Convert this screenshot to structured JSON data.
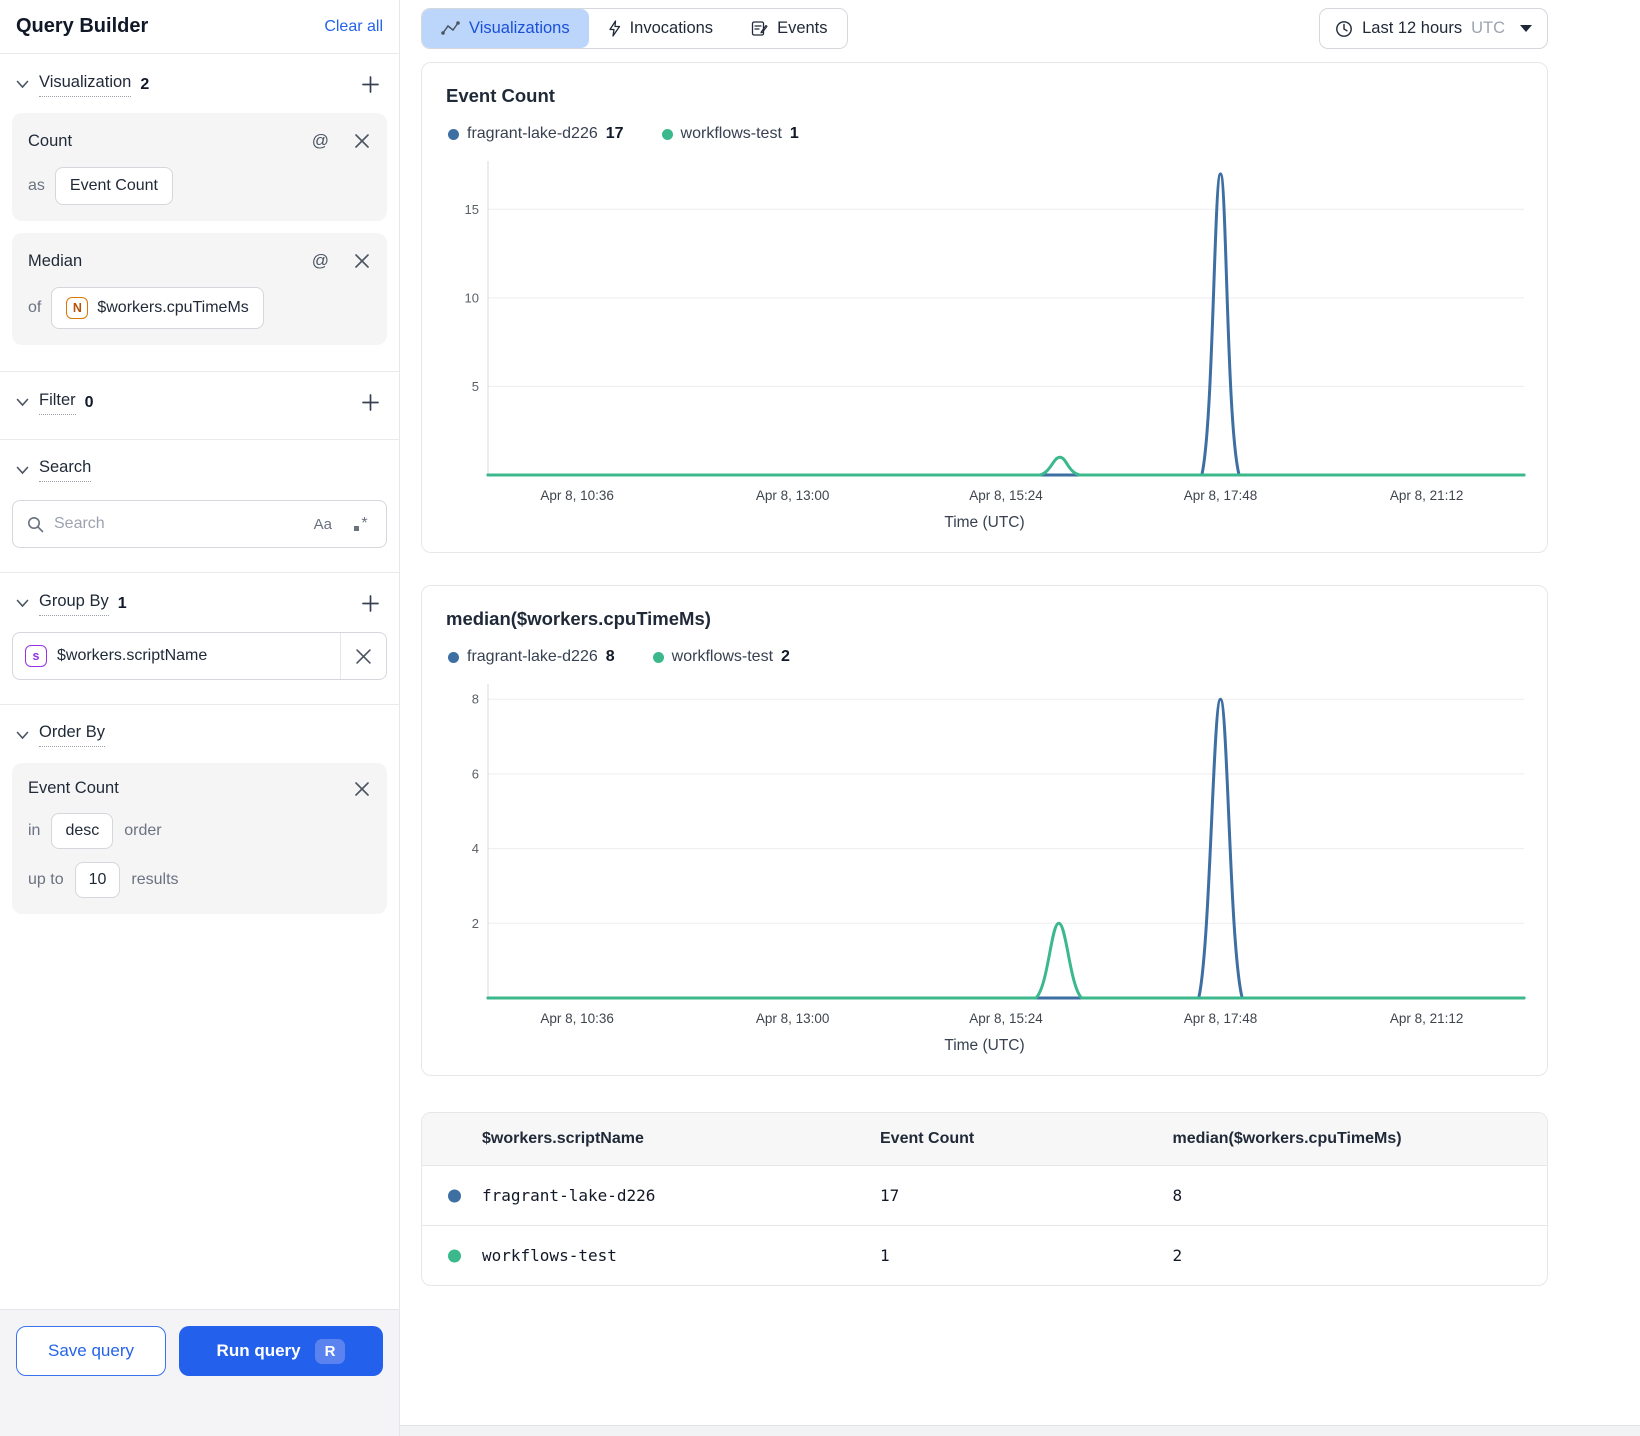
{
  "colors": {
    "accent": "#2563eb",
    "blue_series": "#3d6fa3",
    "green_series": "#3cb98c",
    "tab_selected_bg": "#bcd6fb",
    "tab_selected_text": "#1b4fd8"
  },
  "sidebar": {
    "title": "Query Builder",
    "clear_all": "Clear all",
    "visualization": {
      "label": "Visualization",
      "count": "2"
    },
    "count_card": {
      "title": "Count",
      "as_label": "as",
      "as_value": "Event Count"
    },
    "median_card": {
      "title": "Median",
      "of_label": "of",
      "field_badge": "N",
      "field": "$workers.cpuTimeMs"
    },
    "filter": {
      "label": "Filter",
      "count": "0"
    },
    "search": {
      "label": "Search",
      "placeholder": "Search",
      "case_toggle": "Aa"
    },
    "group_by": {
      "label": "Group By",
      "count": "1",
      "item_badge": "s",
      "item": "$workers.scriptName"
    },
    "order_by": {
      "label": "Order By",
      "card": {
        "title": "Event Count",
        "in_label": "in",
        "direction": "desc",
        "order_label": "order",
        "up_to_label": "up to",
        "limit": "10",
        "results_label": "results"
      }
    },
    "footer": {
      "save": "Save query",
      "run": "Run query",
      "run_shortcut": "R"
    }
  },
  "topbar": {
    "tabs": [
      {
        "label": "Visualizations",
        "selected": true
      },
      {
        "label": "Invocations",
        "selected": false
      },
      {
        "label": "Events",
        "selected": false
      }
    ],
    "time_range": {
      "label": "Last 12 hours",
      "zone": "UTC"
    }
  },
  "chart_data": [
    {
      "type": "line",
      "title": "Event Count",
      "xlabel": "Time (UTC)",
      "ylim": [
        0,
        17.5
      ],
      "y_ticks": [
        5,
        10,
        15
      ],
      "x_ticks": [
        {
          "pos": 0.086,
          "label": "Apr 8, 10:36"
        },
        {
          "pos": 0.294,
          "label": "Apr 8, 13:00"
        },
        {
          "pos": 0.5,
          "label": "Apr 8, 15:24"
        },
        {
          "pos": 0.707,
          "label": "Apr 8, 17:48"
        },
        {
          "pos": 0.906,
          "label": "Apr 8, 21:12"
        }
      ],
      "legend": [
        {
          "name": "fragrant-lake-d226",
          "value": "17",
          "color": "#3d6fa3"
        },
        {
          "name": "workflows-test",
          "value": "1",
          "color": "#3cb98c"
        }
      ],
      "series": [
        {
          "name": "fragrant-lake-d226",
          "color": "#3d6fa3",
          "points": [
            [
              0,
              0
            ],
            [
              0.64,
              0
            ],
            [
              0.689,
              0
            ],
            [
              0.707,
              17
            ],
            [
              0.725,
              0
            ],
            [
              0.78,
              0
            ],
            [
              1,
              0
            ]
          ]
        },
        {
          "name": "workflows-test",
          "color": "#3cb98c",
          "points": [
            [
              0,
              0
            ],
            [
              0.49,
              0
            ],
            [
              0.533,
              0
            ],
            [
              0.552,
              1
            ],
            [
              0.571,
              0
            ],
            [
              0.62,
              0
            ],
            [
              1,
              0
            ]
          ]
        }
      ]
    },
    {
      "type": "line",
      "title": "median($workers.cpuTimeMs)",
      "xlabel": "Time (UTC)",
      "ylim": [
        0,
        8.3
      ],
      "y_ticks": [
        2,
        4,
        6,
        8
      ],
      "x_ticks": [
        {
          "pos": 0.086,
          "label": "Apr 8, 10:36"
        },
        {
          "pos": 0.294,
          "label": "Apr 8, 13:00"
        },
        {
          "pos": 0.5,
          "label": "Apr 8, 15:24"
        },
        {
          "pos": 0.707,
          "label": "Apr 8, 17:48"
        },
        {
          "pos": 0.906,
          "label": "Apr 8, 21:12"
        }
      ],
      "legend": [
        {
          "name": "fragrant-lake-d226",
          "value": "8",
          "color": "#3d6fa3"
        },
        {
          "name": "workflows-test",
          "value": "2",
          "color": "#3cb98c"
        }
      ],
      "series": [
        {
          "name": "fragrant-lake-d226",
          "color": "#3d6fa3",
          "points": [
            [
              0,
              0
            ],
            [
              0.64,
              0
            ],
            [
              0.686,
              0
            ],
            [
              0.707,
              8
            ],
            [
              0.728,
              0
            ],
            [
              0.78,
              0
            ],
            [
              1,
              0
            ]
          ]
        },
        {
          "name": "workflows-test",
          "color": "#3cb98c",
          "points": [
            [
              0,
              0
            ],
            [
              0.48,
              0
            ],
            [
              0.529,
              0
            ],
            [
              0.551,
              2
            ],
            [
              0.573,
              0
            ],
            [
              0.62,
              0
            ],
            [
              1,
              0
            ]
          ]
        }
      ]
    }
  ],
  "table": {
    "headers": [
      "$workers.scriptName",
      "Event Count",
      "median($workers.cpuTimeMs)"
    ],
    "rows": [
      {
        "dot_color": "#3d6fa3",
        "script_name": "fragrant-lake-d226",
        "event_count": "17",
        "median": "8"
      },
      {
        "dot_color": "#3cb98c",
        "script_name": "workflows-test",
        "event_count": "1",
        "median": "2"
      }
    ]
  }
}
